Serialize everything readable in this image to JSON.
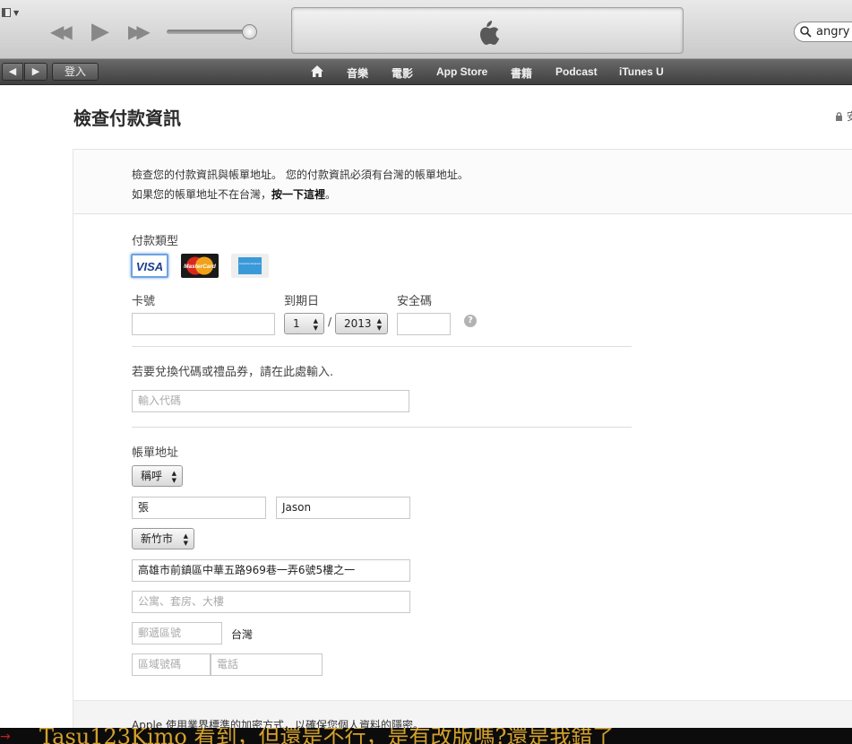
{
  "player": {
    "search_value": "angry b"
  },
  "nav": {
    "back": "◀",
    "forward": "▶",
    "login": "登入",
    "items": [
      "音樂",
      "電影",
      "App Store",
      "書籍",
      "Podcast",
      "iTunes U"
    ]
  },
  "page": {
    "title": "檢查付款資訊",
    "secure_label": "安"
  },
  "intro": {
    "line1": "檢查您的付款資訊與帳單地址。 您的付款資訊必須有台灣的帳單地址。",
    "line2_prefix": "如果您的帳單地址不在台灣，",
    "line2_link": "按一下這裡",
    "line2_suffix": "。"
  },
  "payment": {
    "type_label": "付款類型",
    "cards": [
      "VISA",
      "MasterCard",
      "American Express"
    ],
    "card_number_label": "卡號",
    "card_number_value": "",
    "expiry_label": "到期日",
    "expiry_month": "1",
    "expiry_sep": "/",
    "expiry_year": "2013",
    "cvv_label": "安全碼",
    "cvv_value": "",
    "help": "?"
  },
  "promo": {
    "label": "若要兌換代碼或禮品券，請在此處輸入.",
    "placeholder": "輸入代碼"
  },
  "billing": {
    "label": "帳單地址",
    "salutation": "稱呼",
    "last_name": "張",
    "first_name": "Jason",
    "city": "新竹市",
    "street": "高雄市前鎮區中華五路969巷一弄6號5樓之一",
    "street2_placeholder": "公寓、套房、大樓",
    "postal_placeholder": "郵遞區號",
    "country": "台灣",
    "area_code_placeholder": "區域號碼",
    "phone_placeholder": "電話"
  },
  "footer": {
    "text": "Apple 使用業界標準的加密方式，以確保您個人資料的隱密。"
  },
  "overlay": {
    "text": "Tasu123Kimo 看到，但還是不行，是有改版嗎?還是我錯了"
  }
}
